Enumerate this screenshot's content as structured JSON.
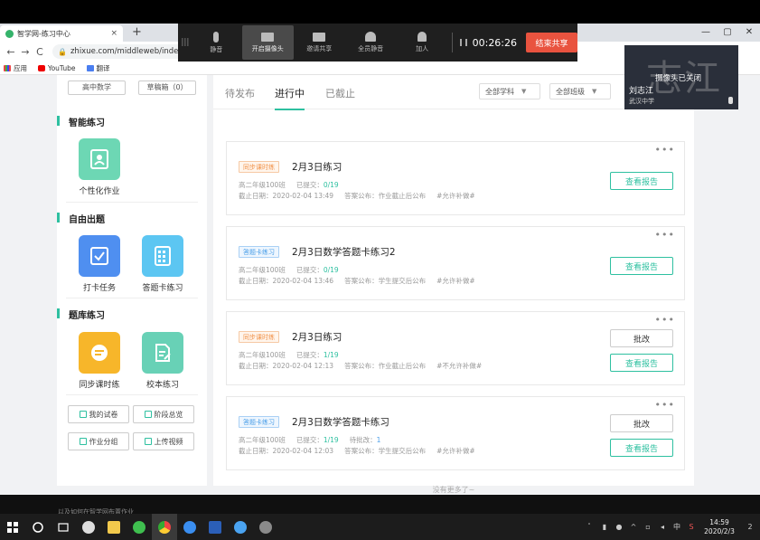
{
  "browser": {
    "tab_title": "智学网-练习中心",
    "tab_close": "×",
    "new_tab": "+",
    "url": "zhixue.com/middleweb/index#/",
    "bookmarks": [
      "应用",
      "YouTube",
      "翻译"
    ],
    "window_controls": [
      "—",
      "▢",
      "✕"
    ]
  },
  "meeting": {
    "items": [
      "静音",
      "开启摄像头",
      "邀请共享",
      "全员静音",
      "加人"
    ],
    "timer": "00:26:26",
    "stop_share": "结束共享"
  },
  "video": {
    "big_name": "志江",
    "camera_off": "摄像头已关闭",
    "person_name": "刘志江",
    "school": "武汉中学"
  },
  "sidebar": {
    "subject_select": "高中数学",
    "draft_box": "草稿箱（0）",
    "sections": [
      {
        "title": "智能练习",
        "tools": [
          "个性化作业"
        ]
      },
      {
        "title": "自由出题",
        "tools": [
          "打卡任务",
          "答题卡练习"
        ]
      },
      {
        "title": "题库练习",
        "tools": [
          "同步课时练",
          "校本练习"
        ]
      }
    ],
    "bottom_buttons": [
      "我的试卷",
      "阶段总览",
      "作业分组",
      "上传视频"
    ]
  },
  "main": {
    "tabs": [
      "待发布",
      "进行中",
      "已截止"
    ],
    "filters": [
      "全部学科",
      "全部班级"
    ],
    "more": "•••",
    "cards": [
      {
        "badge": "同步课时练",
        "title": "2月3日练习",
        "class": "高二年级100班",
        "submitted_label": "已提交：",
        "submitted": "0/19",
        "deadline": "截止日期：2020-02-04 13:49",
        "answer": "答案公布：作业截止后公布",
        "makeup": "#允许补做#",
        "buttons": [
          "查看报告"
        ]
      },
      {
        "badge": "答题卡练习",
        "title": "2月3日数学答题卡练习2",
        "class": "高二年级100班",
        "submitted_label": "已提交：",
        "submitted": "0/19",
        "deadline": "截止日期：2020-02-04 13:46",
        "answer": "答案公布：学生提交后公布",
        "makeup": "#允许补做#",
        "buttons": [
          "查看报告"
        ]
      },
      {
        "badge": "同步课时练",
        "title": "2月3日练习",
        "class": "高二年级100班",
        "submitted_label": "已提交：",
        "submitted": "1/19",
        "deadline": "截止日期：2020-02-04 12:13",
        "answer": "答案公布：作业截止后公布",
        "makeup": "#不允许补做#",
        "buttons": [
          "批改",
          "查看报告"
        ]
      },
      {
        "badge": "答题卡练习",
        "title": "2月3日数学答题卡练习",
        "class": "高二年级100班",
        "submitted_label": "已提交：",
        "submitted": "1/19",
        "pending_label": "待批改：",
        "pending": "1",
        "deadline": "截止日期：2020-02-04 12:03",
        "answer": "答案公布：学生提交后公布",
        "makeup": "#允许补做#",
        "buttons": [
          "批改",
          "查看报告"
        ]
      }
    ],
    "no_more": "没有更多了~"
  },
  "bottom_handwriting": "以及如何在智学网布置作业",
  "taskbar": {
    "ime": "中",
    "time": "14:59",
    "date": "2020/2/3",
    "notifications": "2"
  },
  "colors": {
    "accent": "#2ec0a0",
    "orange_badge": "#f1924a",
    "blue_badge": "#4a9ee8",
    "stop_share": "#e9533f"
  }
}
